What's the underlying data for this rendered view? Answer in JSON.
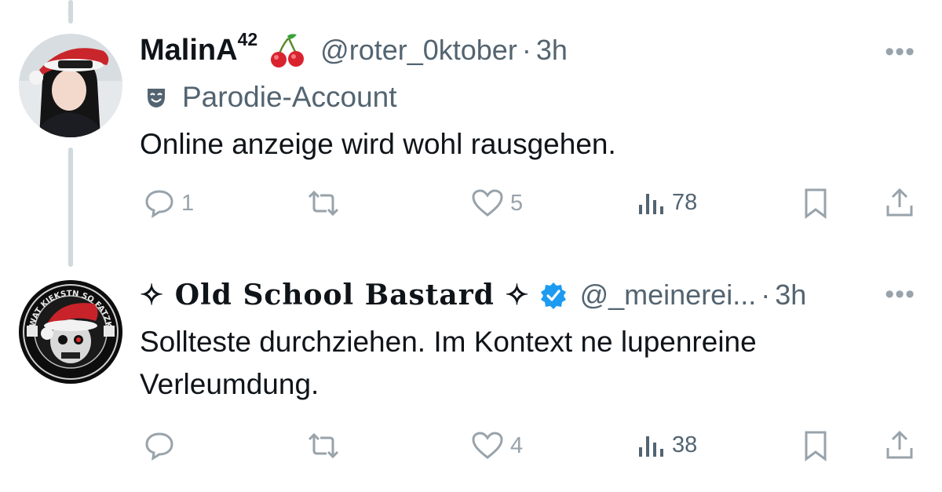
{
  "tweets": [
    {
      "display_name": "MalinA",
      "name_superscript": "42",
      "name_emoji": "cherries",
      "handle": "@roter_0ktober",
      "separator": "·",
      "time": "3h",
      "more": "•••",
      "label": "Parodie-Account",
      "text": "Online anzeige wird wohl rausgehen.",
      "actions": {
        "replies": "1",
        "retweets": "",
        "likes": "5",
        "views": "78"
      }
    },
    {
      "display_name": "✧ Old School Bastard ✧",
      "verified": true,
      "handle": "@_meinerei...",
      "separator": "·",
      "time": "3h",
      "more": "•••",
      "text_line1": "Sollteste durchziehen. Im Kontext ne lupenreine",
      "text_line2": "Verleumdung.",
      "avatar_text": "WAT KIEKSTN SO FATZKE?",
      "actions": {
        "replies": "",
        "retweets": "",
        "likes": "4",
        "views": "38"
      }
    }
  ],
  "colors": {
    "primary_text": "#0f1419",
    "secondary_text": "#536471",
    "icon_gray": "#98a3ab",
    "thread_line": "#cfd9de",
    "verified_blue": "#1d9bf0"
  }
}
